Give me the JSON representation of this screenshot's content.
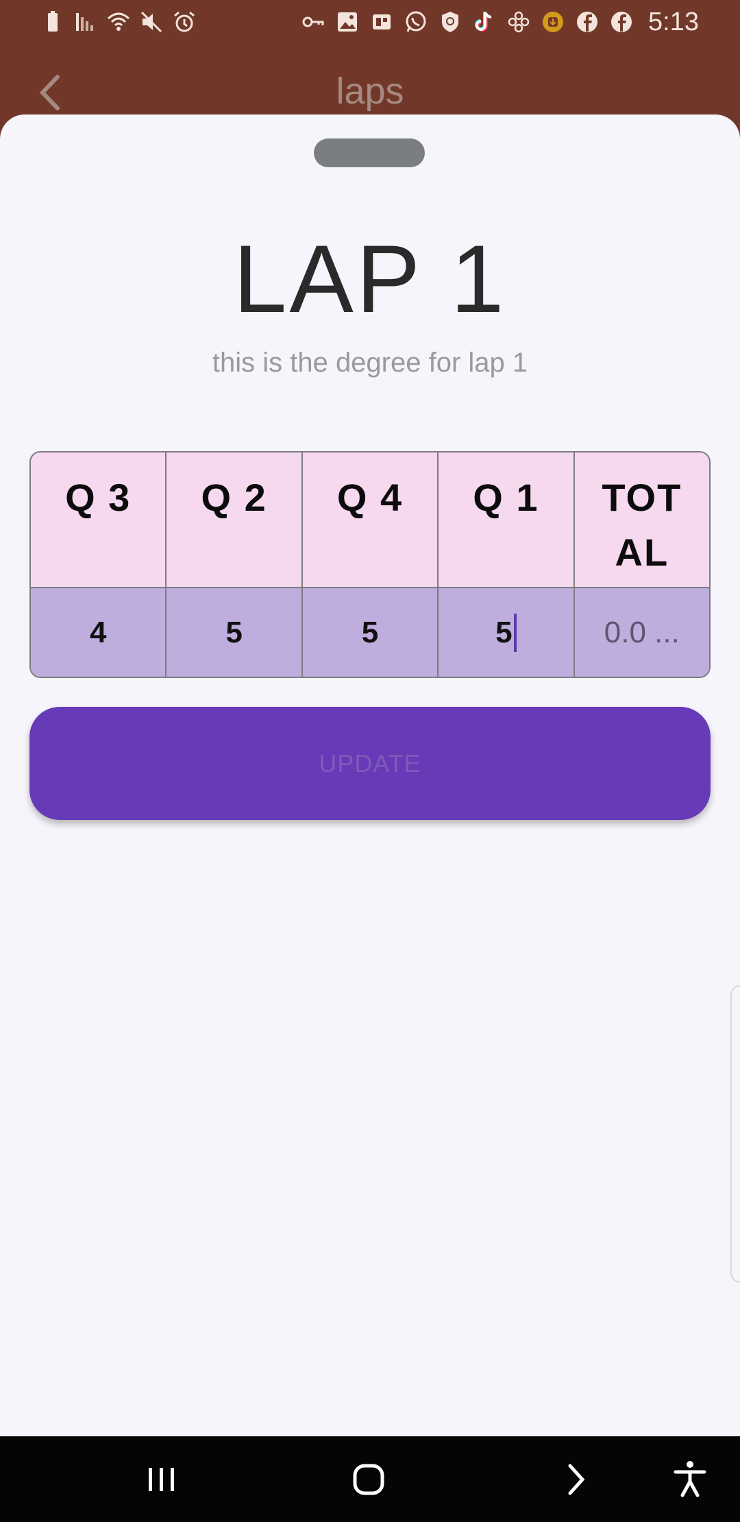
{
  "status_bar": {
    "time": "5:13",
    "left_icons": [
      "battery-icon",
      "signal-icon",
      "wifi-icon",
      "mute-icon",
      "alarm-icon"
    ],
    "right_icons": [
      "key-icon",
      "gallery-icon",
      "app-icon",
      "whatsapp-icon",
      "shield-icon",
      "tiktok-icon",
      "flower-icon",
      "download-badge-icon",
      "facebook-icon",
      "facebook-icon"
    ]
  },
  "app_bar": {
    "title": "laps"
  },
  "sheet": {
    "title": "LAP 1",
    "subtitle": "this is the degree for lap 1",
    "table": {
      "headers": [
        "Q 3",
        "Q 2",
        "Q 4",
        "Q 1",
        "TOTAL"
      ],
      "values": [
        "4",
        "5",
        "5",
        "5",
        "0.0 ..."
      ],
      "header_color": "#f6d9ef",
      "value_color": "#bfadde"
    },
    "update_label": "UPDATE",
    "accent_color": "#673ab7"
  },
  "nav_bar": {
    "buttons": [
      "recents-icon",
      "home-icon",
      "back-icon",
      "accessibility-icon"
    ]
  }
}
